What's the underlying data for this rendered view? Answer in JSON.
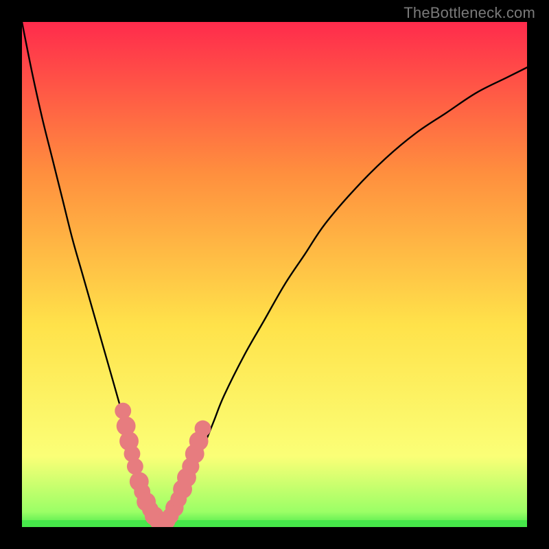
{
  "watermark": "TheBottleneck.com",
  "colors": {
    "frame": "#000000",
    "curve": "#000000",
    "marker_fill": "#e77c7f",
    "marker_stroke": "#d66",
    "greenband": "#47e84a",
    "gradient_top": "#ff2b4c",
    "gradient_mid1": "#ff8f3e",
    "gradient_mid2": "#ffe24a",
    "gradient_low": "#fbff77",
    "gradient_green": "#47e84a"
  },
  "chart_data": {
    "type": "line",
    "title": "",
    "xlabel": "",
    "ylabel": "",
    "xlim": [
      0,
      100
    ],
    "ylim": [
      0,
      100
    ],
    "x": [
      0,
      2,
      4,
      6,
      8,
      10,
      12,
      14,
      16,
      18,
      20,
      21,
      22,
      23,
      24,
      25,
      26,
      27,
      28,
      29,
      30,
      32,
      34,
      36,
      38,
      40,
      44,
      48,
      52,
      56,
      60,
      66,
      72,
      78,
      84,
      90,
      96,
      100
    ],
    "y": [
      100,
      90,
      81,
      73,
      65,
      57,
      50,
      43,
      36,
      29,
      22,
      19,
      15,
      12,
      8,
      5,
      3,
      2,
      1,
      1,
      2,
      6,
      11,
      16,
      21,
      26,
      34,
      41,
      48,
      54,
      60,
      67,
      73,
      78,
      82,
      86,
      89,
      91
    ],
    "minimum_x": 27.5,
    "markers": [
      {
        "x": 20.0,
        "y": 23.0,
        "r": 1.2
      },
      {
        "x": 20.6,
        "y": 20.0,
        "r": 1.5
      },
      {
        "x": 21.2,
        "y": 17.0,
        "r": 1.5
      },
      {
        "x": 21.8,
        "y": 14.5,
        "r": 1.2
      },
      {
        "x": 22.4,
        "y": 12.0,
        "r": 1.2
      },
      {
        "x": 23.2,
        "y": 9.0,
        "r": 1.5
      },
      {
        "x": 23.8,
        "y": 7.0,
        "r": 1.2
      },
      {
        "x": 24.6,
        "y": 5.0,
        "r": 1.5
      },
      {
        "x": 25.4,
        "y": 3.5,
        "r": 1.2
      },
      {
        "x": 26.2,
        "y": 2.2,
        "r": 1.5
      },
      {
        "x": 27.0,
        "y": 1.3,
        "r": 1.4
      },
      {
        "x": 27.8,
        "y": 1.0,
        "r": 1.3
      },
      {
        "x": 28.6,
        "y": 1.3,
        "r": 1.4
      },
      {
        "x": 29.4,
        "y": 2.2,
        "r": 1.2
      },
      {
        "x": 30.2,
        "y": 3.8,
        "r": 1.4
      },
      {
        "x": 31.0,
        "y": 5.5,
        "r": 1.2
      },
      {
        "x": 31.8,
        "y": 7.5,
        "r": 1.5
      },
      {
        "x": 32.6,
        "y": 9.8,
        "r": 1.5
      },
      {
        "x": 33.4,
        "y": 12.0,
        "r": 1.3
      },
      {
        "x": 34.2,
        "y": 14.5,
        "r": 1.5
      },
      {
        "x": 35.0,
        "y": 17.0,
        "r": 1.5
      },
      {
        "x": 35.8,
        "y": 19.5,
        "r": 1.2
      }
    ]
  }
}
